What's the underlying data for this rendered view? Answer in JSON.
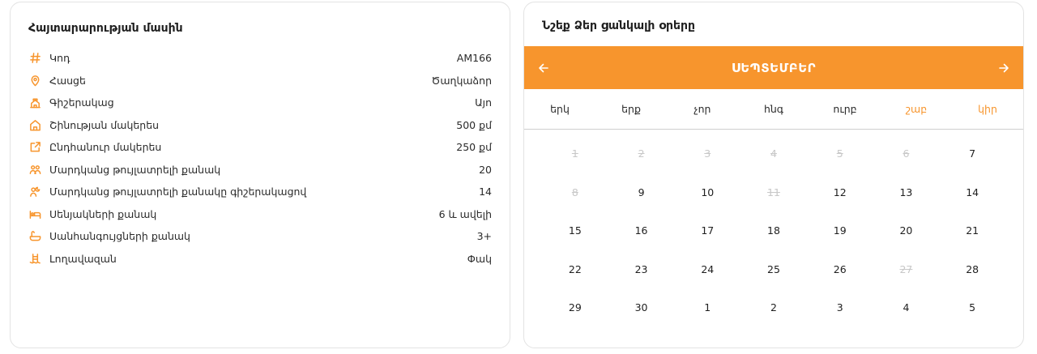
{
  "info": {
    "title": "Հայտարարության մասին",
    "rows": [
      {
        "icon": "hash-icon",
        "label": "Կոդ",
        "value": "AM166"
      },
      {
        "icon": "location-pin-icon",
        "label": "Հասցե",
        "value": "Ծաղկաձոր"
      },
      {
        "icon": "house-night-icon",
        "label": "Գիշերակաց",
        "value": "Այո"
      },
      {
        "icon": "building-area-icon",
        "label": "Շինության մակերես",
        "value": "500 քմ"
      },
      {
        "icon": "total-area-icon",
        "label": "Ընդհանուր մակերես",
        "value": "250 քմ"
      },
      {
        "icon": "people-icon",
        "label": "Մարդկանց թույլատրելի քանակ",
        "value": "20"
      },
      {
        "icon": "people-overnight-icon",
        "label": "Մարդկանց թույլատրելի քանակը գիշերակացով",
        "value": "14"
      },
      {
        "icon": "bed-icon",
        "label": "Սենյակների քանակ",
        "value": "6 և ավելի"
      },
      {
        "icon": "bathtub-icon",
        "label": "Սանհանգույցների քանակ",
        "value": "3+"
      },
      {
        "icon": "pool-ladder-icon",
        "label": "Լողավազան",
        "value": "Փակ"
      }
    ]
  },
  "calendar": {
    "title": "Նշեք Ձեր ցանկալի օրերը",
    "month": "ՍԵՊՏԵՄԲԵՐ",
    "accent": "#f7952d",
    "weekdays": [
      {
        "label": "երկ",
        "weekend": false
      },
      {
        "label": "երք",
        "weekend": false
      },
      {
        "label": "չոր",
        "weekend": false
      },
      {
        "label": "հնգ",
        "weekend": false
      },
      {
        "label": "ուրբ",
        "weekend": false
      },
      {
        "label": "շաբ",
        "weekend": true
      },
      {
        "label": "կիր",
        "weekend": true
      }
    ],
    "days": [
      {
        "d": "1",
        "disabled": true
      },
      {
        "d": "2",
        "disabled": true
      },
      {
        "d": "3",
        "disabled": true
      },
      {
        "d": "4",
        "disabled": true
      },
      {
        "d": "5",
        "disabled": true
      },
      {
        "d": "6",
        "disabled": true
      },
      {
        "d": "7",
        "disabled": false
      },
      {
        "d": "8",
        "disabled": true
      },
      {
        "d": "9",
        "disabled": false
      },
      {
        "d": "10",
        "disabled": false
      },
      {
        "d": "11",
        "disabled": true
      },
      {
        "d": "12",
        "disabled": false
      },
      {
        "d": "13",
        "disabled": false
      },
      {
        "d": "14",
        "disabled": false
      },
      {
        "d": "15",
        "disabled": false
      },
      {
        "d": "16",
        "disabled": false
      },
      {
        "d": "17",
        "disabled": false
      },
      {
        "d": "18",
        "disabled": false
      },
      {
        "d": "19",
        "disabled": false
      },
      {
        "d": "20",
        "disabled": false
      },
      {
        "d": "21",
        "disabled": false
      },
      {
        "d": "22",
        "disabled": false
      },
      {
        "d": "23",
        "disabled": false
      },
      {
        "d": "24",
        "disabled": false
      },
      {
        "d": "25",
        "disabled": false
      },
      {
        "d": "26",
        "disabled": false
      },
      {
        "d": "27",
        "disabled": true
      },
      {
        "d": "28",
        "disabled": false
      },
      {
        "d": "29",
        "disabled": false
      },
      {
        "d": "30",
        "disabled": false
      },
      {
        "d": "1",
        "disabled": false
      },
      {
        "d": "2",
        "disabled": false
      },
      {
        "d": "3",
        "disabled": false
      },
      {
        "d": "4",
        "disabled": false
      },
      {
        "d": "5",
        "disabled": false
      }
    ]
  }
}
